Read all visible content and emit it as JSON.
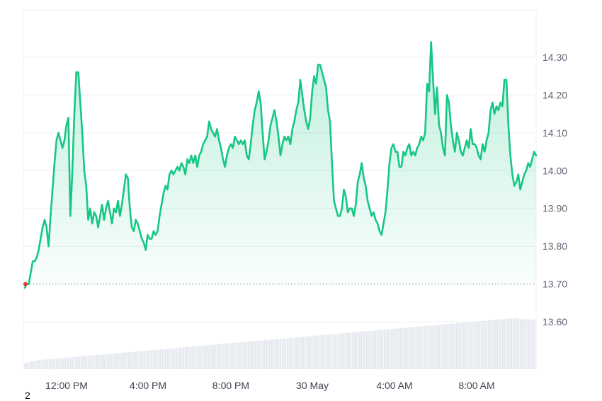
{
  "chart_data": {
    "type": "line",
    "grid": true,
    "baseline": 13.7,
    "ylim": [
      13.475,
      14.425
    ],
    "y_ticks": [
      "14.30",
      "14.20",
      "14.10",
      "14.00",
      "13.90",
      "13.80",
      "13.70",
      "13.60"
    ],
    "x_ticks": [
      "12:00 PM",
      "4:00 PM",
      "8:00 PM",
      "30 May",
      "4:00 AM",
      "8:00 AM"
    ],
    "colors": {
      "line": "#16c784",
      "baseline": "#8a8f98",
      "start_marker": "#ea3943",
      "volume": "#e4e8ee",
      "grid": "#edf0f3"
    },
    "series": [
      {
        "type": "line",
        "values": [
          13.69,
          13.7,
          13.7,
          13.73,
          13.76,
          13.76,
          13.77,
          13.79,
          13.82,
          13.85,
          13.87,
          13.85,
          13.8,
          13.88,
          13.95,
          14.02,
          14.08,
          14.1,
          14.08,
          14.06,
          14.08,
          14.12,
          14.14,
          13.88,
          14.0,
          14.15,
          14.26,
          14.26,
          14.18,
          14.1,
          14.0,
          13.96,
          13.87,
          13.9,
          13.86,
          13.89,
          13.88,
          13.85,
          13.88,
          13.91,
          13.87,
          13.9,
          13.92,
          13.89,
          13.86,
          13.9,
          13.89,
          13.92,
          13.88,
          13.91,
          13.95,
          13.99,
          13.98,
          13.9,
          13.85,
          13.84,
          13.87,
          13.86,
          13.84,
          13.82,
          13.81,
          13.79,
          13.83,
          13.82,
          13.82,
          13.84,
          13.83,
          13.84,
          13.88,
          13.91,
          13.94,
          13.96,
          13.95,
          13.99,
          14.0,
          13.99,
          14.0,
          14.01,
          14.0,
          14.02,
          14.01,
          13.99,
          14.03,
          14.02,
          14.04,
          14.02,
          14.04,
          14.01,
          14.04,
          14.05,
          14.07,
          14.08,
          14.09,
          14.13,
          14.11,
          14.1,
          14.09,
          14.11,
          14.08,
          14.06,
          14.03,
          14.01,
          14.04,
          14.06,
          14.07,
          14.06,
          14.09,
          14.08,
          14.07,
          14.08,
          14.07,
          14.08,
          14.04,
          14.03,
          14.07,
          14.12,
          14.16,
          14.18,
          14.21,
          14.18,
          14.1,
          14.03,
          14.05,
          14.08,
          14.12,
          14.14,
          14.16,
          14.13,
          14.09,
          14.04,
          14.07,
          14.09,
          14.08,
          14.09,
          14.07,
          14.11,
          14.13,
          14.16,
          14.18,
          14.24,
          14.2,
          14.16,
          14.13,
          14.11,
          14.14,
          14.21,
          14.25,
          14.23,
          14.28,
          14.28,
          14.26,
          14.24,
          14.22,
          14.16,
          14.13,
          14.02,
          13.92,
          13.9,
          13.88,
          13.88,
          13.9,
          13.95,
          13.93,
          13.89,
          13.9,
          13.9,
          13.88,
          13.91,
          13.97,
          13.99,
          14.02,
          13.98,
          13.96,
          13.92,
          13.9,
          13.88,
          13.89,
          13.87,
          13.86,
          13.84,
          13.83,
          13.86,
          13.89,
          13.95,
          14.02,
          14.06,
          14.07,
          14.05,
          14.05,
          14.01,
          14.01,
          14.05,
          14.04,
          14.06,
          14.07,
          14.04,
          14.05,
          14.04,
          14.06,
          14.07,
          14.09,
          14.08,
          14.1,
          14.23,
          14.21,
          14.34,
          14.24,
          14.15,
          14.22,
          14.12,
          14.1,
          14.06,
          14.04,
          14.2,
          14.18,
          14.12,
          14.08,
          14.05,
          14.1,
          14.08,
          14.05,
          14.04,
          14.06,
          14.08,
          14.06,
          14.11,
          14.07,
          14.07,
          14.06,
          14.04,
          14.03,
          14.07,
          14.05,
          14.08,
          14.1,
          14.16,
          14.18,
          14.15,
          14.17,
          14.16,
          14.18,
          14.17,
          14.24,
          14.24,
          14.12,
          14.04,
          13.99,
          13.96,
          13.97,
          13.99,
          13.95,
          13.97,
          13.99,
          14.0,
          14.02,
          14.01,
          14.03,
          14.05,
          14.04
        ]
      },
      {
        "type": "volume",
        "values": [
          0.0,
          2.1,
          3.0,
          4.0,
          4.9,
          5.6,
          6.2,
          6.8,
          7.3,
          7.7,
          8.1,
          8.5,
          8.9,
          9.2,
          9.6,
          9.9,
          10.3,
          10.6,
          11.0,
          11.3,
          11.7,
          12.0,
          12.3,
          12.7,
          13.0,
          13.4,
          13.7,
          14.1,
          14.4,
          14.8,
          15.1,
          15.4,
          15.8,
          16.1,
          16.5,
          16.8,
          17.2,
          17.5,
          17.8,
          18.2,
          18.5,
          18.9,
          19.2,
          19.6,
          19.9,
          20.2,
          20.6,
          20.9,
          21.3,
          21.6,
          22.0,
          22.3,
          22.7,
          23.0,
          23.3,
          23.7,
          24.0,
          24.4,
          24.7,
          25.1,
          25.4,
          25.7,
          26.1,
          26.4,
          26.8,
          27.1,
          27.5,
          27.8,
          28.1,
          28.5,
          28.8,
          29.2,
          29.5,
          29.9,
          30.2,
          30.6,
          30.9,
          31.2,
          31.6,
          31.9,
          32.3,
          32.6,
          33.0,
          33.3,
          33.6,
          34.0,
          34.3,
          34.7,
          35.0,
          35.4,
          35.7,
          36.1,
          36.4,
          36.7,
          37.1,
          37.4,
          37.8,
          38.1,
          38.5,
          38.8,
          39.1,
          39.5,
          39.8,
          40.2,
          40.5,
          40.9,
          41.2,
          41.5,
          41.9,
          42.2,
          42.6,
          42.9,
          43.3,
          43.6,
          44.0,
          44.3,
          44.6,
          45.0,
          45.3,
          45.7,
          46.0,
          46.4,
          46.7,
          47.0,
          47.4,
          47.7,
          48.1,
          48.4,
          48.8,
          49.1,
          49.5,
          49.8,
          50.1,
          50.5,
          50.8,
          51.2,
          51.5,
          51.9,
          52.2,
          52.5,
          52.9,
          53.2,
          53.6,
          53.9,
          54.3,
          54.6,
          55.0,
          55.3,
          55.6,
          56.0,
          56.3,
          56.7,
          57.0,
          57.4,
          57.7,
          58.0,
          58.4,
          58.7,
          59.1,
          59.4,
          59.8,
          60.1,
          60.5,
          60.8,
          61.1,
          61.5,
          61.8,
          62.2,
          62.5,
          62.9,
          63.2,
          63.5,
          63.9,
          64.2,
          64.6,
          64.9,
          65.3,
          65.6,
          66.0,
          66.3,
          66.6,
          67.0,
          67.3,
          67.7,
          68.0,
          68.4,
          68.7,
          69.0,
          69.4,
          69.7,
          70.1,
          70.4,
          70.8,
          71.1,
          71.5,
          71.8,
          72.1,
          72.5,
          72.8,
          73.2,
          73.5,
          73.9,
          74.2,
          74.5,
          74.9,
          75.2,
          75.6,
          75.9,
          76.3,
          76.6,
          77.0,
          77.3,
          77.6,
          78.0,
          78.3,
          78.7,
          79.0,
          79.4,
          79.7,
          80.0,
          80.4,
          80.7,
          81.1,
          81.4,
          81.8,
          82.1,
          82.5,
          82.8,
          83.1,
          83.5,
          83.8,
          84.2,
          84.5,
          84.9,
          85.2,
          85.5,
          85.9,
          86.2,
          86.6,
          86.9,
          87.3,
          87.6,
          88.0,
          88.3,
          88.6,
          89.0,
          89.3,
          89.7,
          90.0,
          90.4,
          90.7,
          91.0,
          91.4,
          91.7,
          92.1,
          92.4,
          92.8,
          93.1,
          93.5,
          93.8,
          94.1,
          94.5,
          94.8,
          95.2,
          95.5,
          95.9,
          96.2,
          96.5,
          96.9,
          97.2,
          97.6,
          97.9,
          98.3,
          98.6,
          99.0,
          99.3,
          99.6,
          100.0,
          99.9,
          99.5,
          99.0,
          98.7,
          98.4,
          98.1,
          97.9,
          97.6,
          97.4,
          97.2,
          97.1,
          97.0
        ]
      }
    ]
  },
  "footnote": "2"
}
